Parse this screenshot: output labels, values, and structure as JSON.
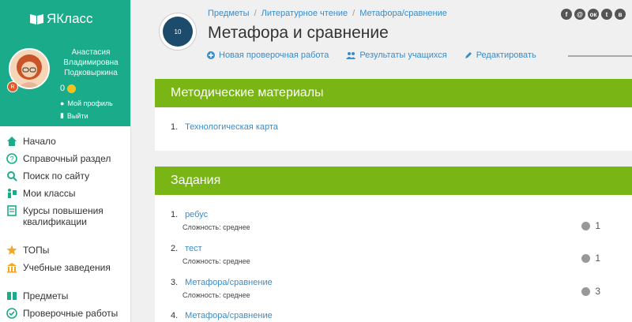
{
  "brand": {
    "name": "ЯКласс"
  },
  "profile": {
    "name_line1": "Анастасия",
    "name_line2": "Владимировна",
    "name_line3": "Подковыркина",
    "points": "0",
    "badge": "R",
    "my_profile": "Мой профиль",
    "logout": "Выйти"
  },
  "nav": {
    "home": "Начало",
    "reference": "Справочный раздел",
    "search": "Поиск по сайту",
    "classes": "Мои классы",
    "courses": "Курсы повышения квалификации",
    "tops": "ТОПы",
    "schools": "Учебные заведения",
    "subjects": "Предметы",
    "tests": "Проверочные работы"
  },
  "breadcrumb": [
    "Предметы",
    "Литературное чтение",
    "Метафора/сравнение"
  ],
  "title": "Метафора и сравнение",
  "topic_icon_text": "10",
  "actions": {
    "new_test": "Новая проверочная работа",
    "results": "Результаты учащихся",
    "edit": "Редактировать"
  },
  "social": [
    "f",
    "@",
    "ок",
    "t",
    "в"
  ],
  "materials": {
    "header": "Методические материалы",
    "items": [
      {
        "num": "1.",
        "label": "Технологическая карта"
      }
    ]
  },
  "tasks": {
    "header": "Задания",
    "difficulty_prefix": "Сложность: среднее",
    "items": [
      {
        "num": "1.",
        "label": "ребус",
        "difficulty": "Сложность: среднее",
        "score": "1"
      },
      {
        "num": "2.",
        "label": "тест",
        "difficulty": "Сложность: среднее",
        "score": "1"
      },
      {
        "num": "3.",
        "label": "Метафора/сравнение",
        "difficulty": "Сложность: среднее",
        "score": "3"
      },
      {
        "num": "4.",
        "label": "Метафора/сравнение",
        "difficulty": "",
        "score": ""
      }
    ]
  },
  "colors": {
    "brand": "#1aab8a",
    "accent": "#7ab516",
    "link": "#3a8cc9"
  }
}
